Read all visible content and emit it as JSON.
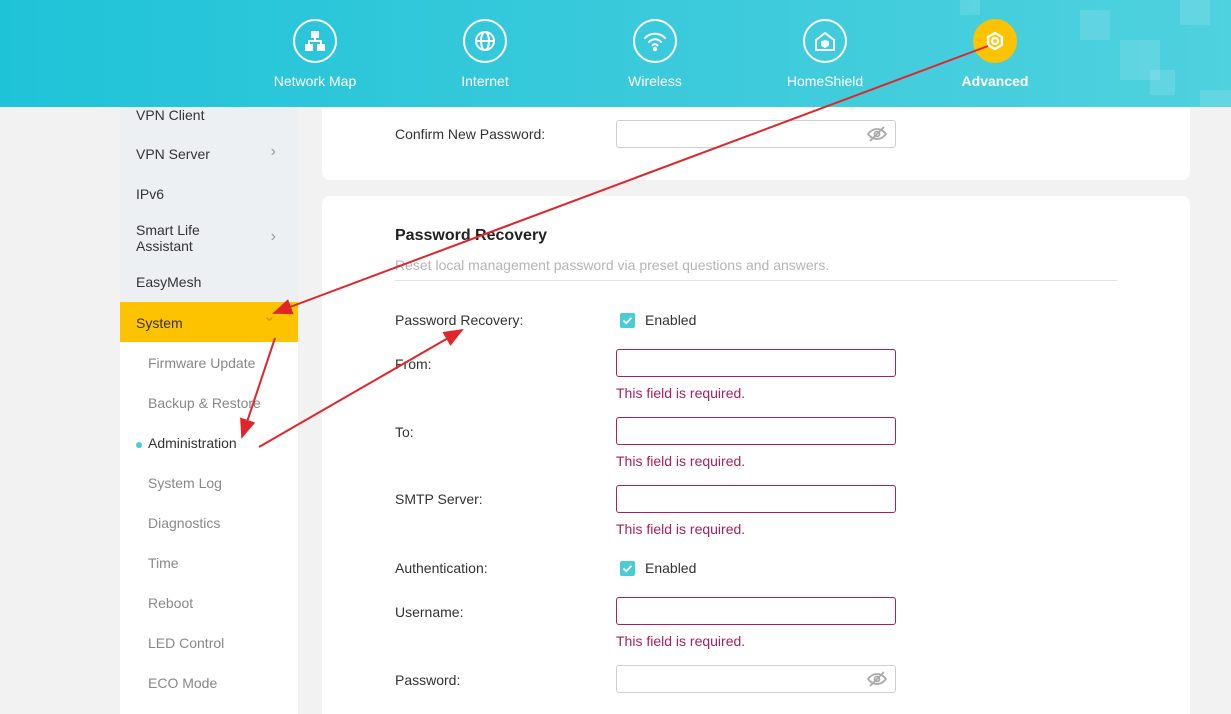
{
  "nav": {
    "items": [
      {
        "label": "Network Map",
        "icon": "network-map-icon"
      },
      {
        "label": "Internet",
        "icon": "globe-icon"
      },
      {
        "label": "Wireless",
        "icon": "wifi-icon"
      },
      {
        "label": "HomeShield",
        "icon": "home-shield-icon"
      },
      {
        "label": "Advanced",
        "icon": "gear-icon",
        "active": true
      }
    ]
  },
  "sidebar": {
    "items": [
      {
        "label": "VPN Client"
      },
      {
        "label": "VPN Server",
        "chevron": "›"
      },
      {
        "label": "IPv6"
      },
      {
        "label": "Smart Life Assistant",
        "chevron": "›"
      },
      {
        "label": "EasyMesh"
      }
    ],
    "system": {
      "label": "System",
      "chevron": "⌄"
    },
    "sub_items": [
      {
        "label": "Firmware Update"
      },
      {
        "label": "Backup & Restore"
      },
      {
        "label": "Administration",
        "active": true
      },
      {
        "label": "System Log"
      },
      {
        "label": "Diagnostics"
      },
      {
        "label": "Time"
      },
      {
        "label": "Reboot"
      },
      {
        "label": "LED Control"
      },
      {
        "label": "ECO Mode"
      }
    ]
  },
  "account_card": {
    "confirm_label": "Confirm New Password:",
    "confirm_value": ""
  },
  "recovery": {
    "title": "Password Recovery",
    "subtitle": "Reset local management password via preset questions and answers.",
    "recovery_label": "Password Recovery:",
    "recovery_checkbox": "Enabled",
    "from_label": "From:",
    "to_label": "To:",
    "smtp_label": "SMTP Server:",
    "auth_label": "Authentication:",
    "auth_checkbox": "Enabled",
    "username_label": "Username:",
    "password_label": "Password:",
    "required_error": "This field is required."
  },
  "colors": {
    "accent": "#4acbd6",
    "active": "#fdc300",
    "error": "#a8205c",
    "annotation": "#e0262b"
  }
}
